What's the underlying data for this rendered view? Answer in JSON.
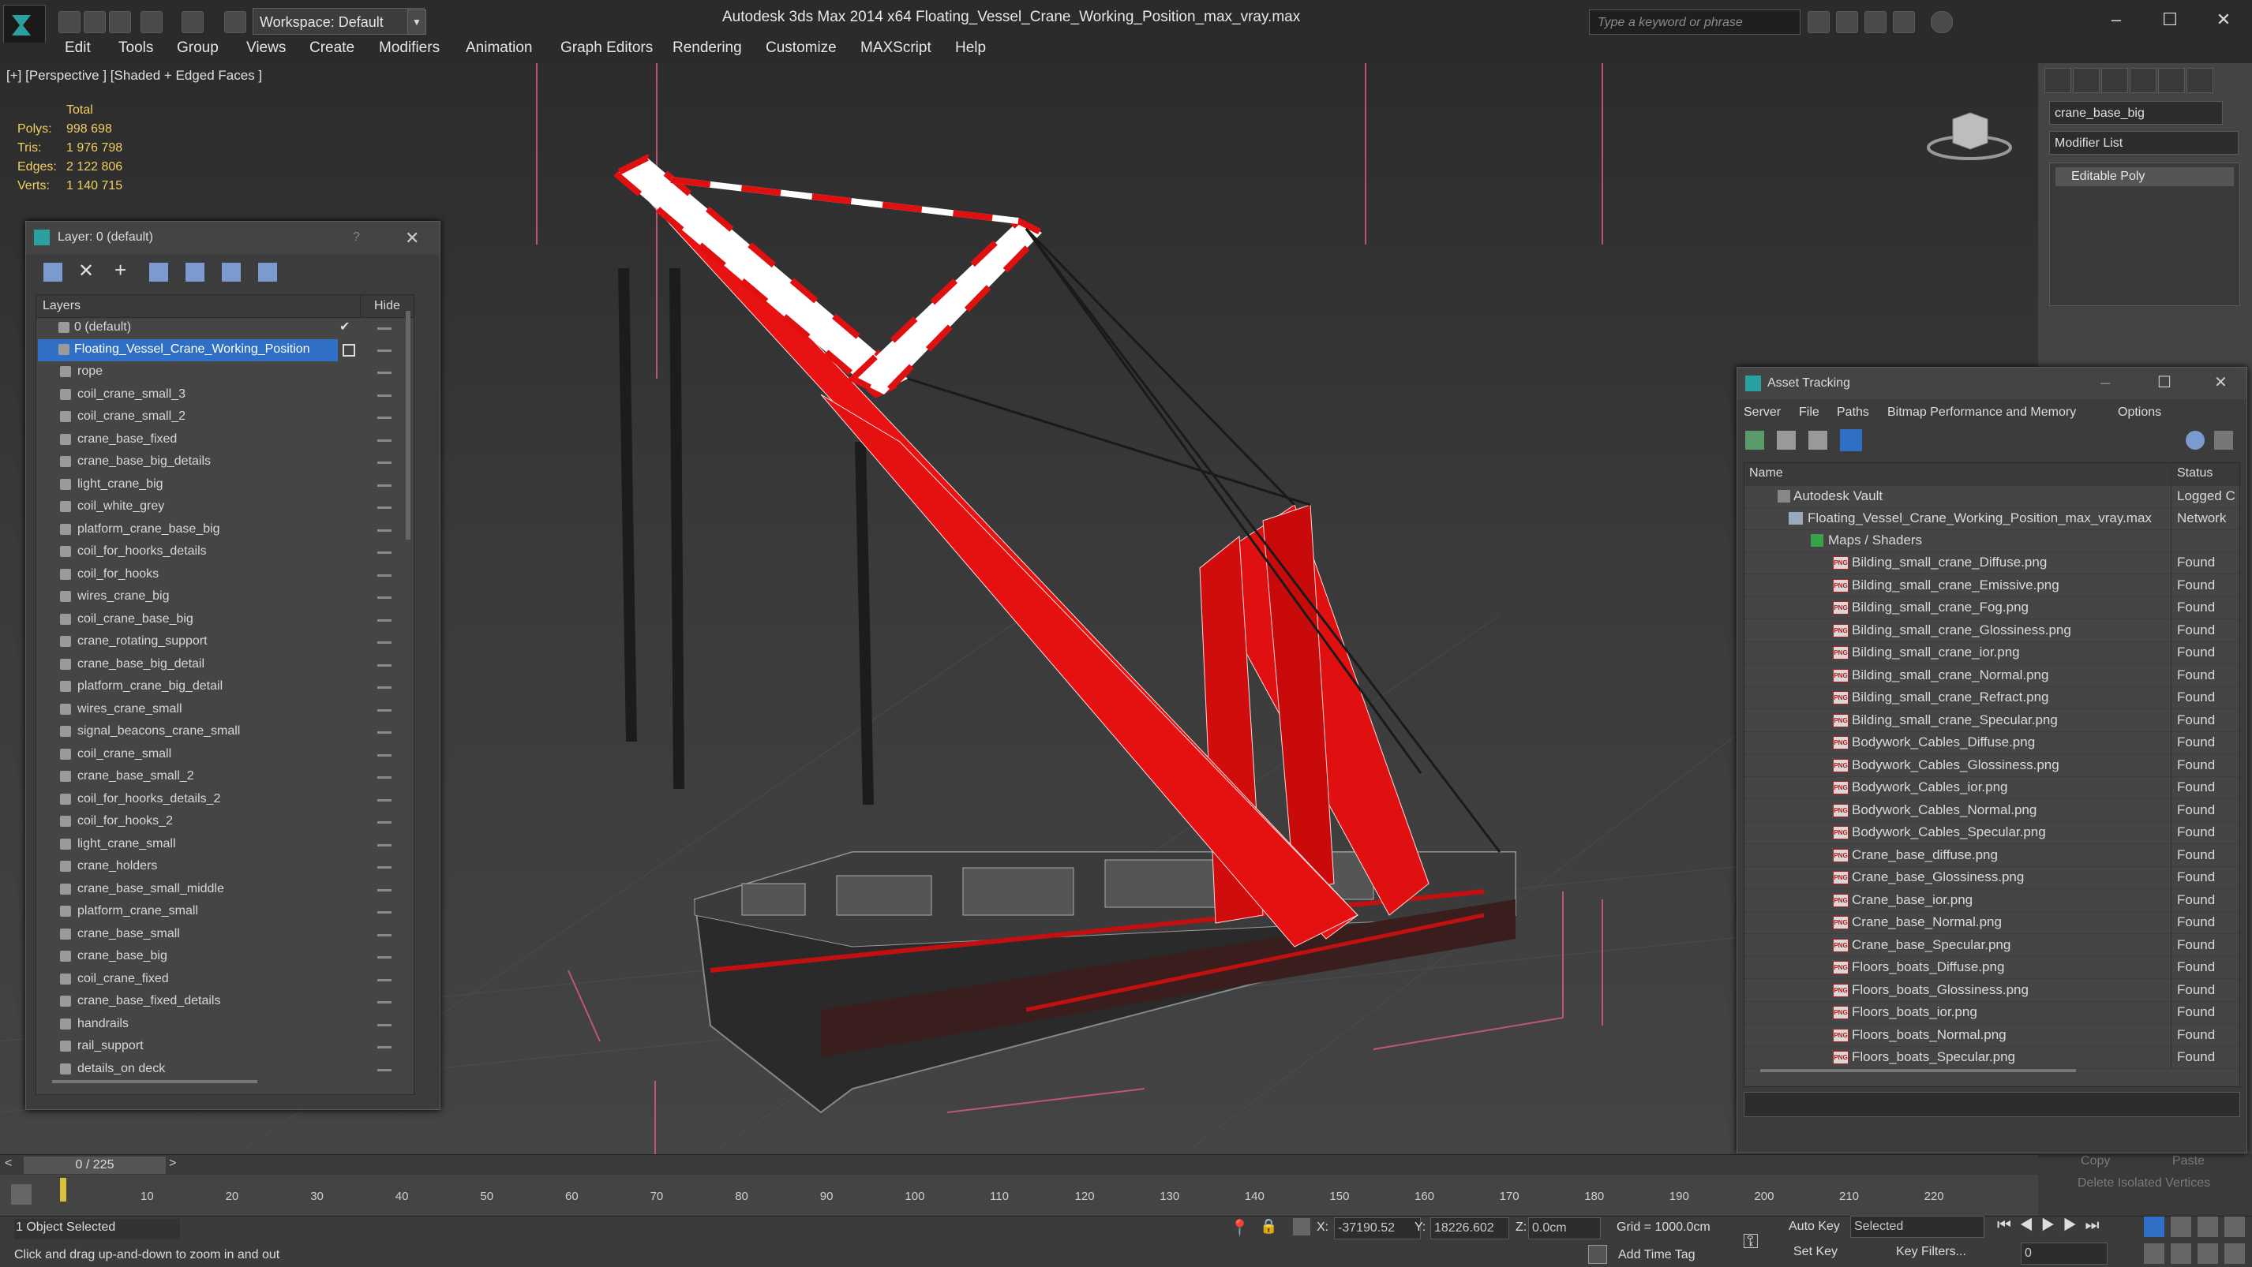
{
  "app": {
    "title": "Autodesk 3ds Max  2014 x64     Floating_Vessel_Crane_Working_Position_max_vray.max",
    "workspace": "Workspace: Default",
    "search_placeholder": "Type a keyword or phrase"
  },
  "menu": [
    "Edit",
    "Tools",
    "Group",
    "Views",
    "Create",
    "Modifiers",
    "Animation",
    "Graph Editors",
    "Rendering",
    "Customize",
    "MAXScript",
    "Help"
  ],
  "viewport": {
    "label": "[+] [Perspective ] [Shaded + Edged Faces ]",
    "stats": {
      "total_label": "Total",
      "rows": [
        {
          "key": "Polys:",
          "value": "998 698"
        },
        {
          "key": "Tris:",
          "value": "1 976 798"
        },
        {
          "key": "Edges:",
          "value": "2 122 806"
        },
        {
          "key": "Verts:",
          "value": "1 140 715"
        }
      ]
    }
  },
  "layer_panel": {
    "title": "Layer: 0 (default)",
    "help": "?",
    "col_layers": "Layers",
    "col_hide": "Hide",
    "default_layer": "0 (default)",
    "selected_layer": "Floating_Vessel_Crane_Working_Position",
    "objects": [
      "rope",
      "coil_crane_small_3",
      "coil_crane_small_2",
      "crane_base_fixed",
      "crane_base_big_details",
      "light_crane_big",
      "coil_white_grey",
      "platform_crane_base_big",
      "coil_for_hoorks_details",
      "coil_for_hooks",
      "wires_crane_big",
      "coil_crane_base_big",
      "crane_rotating_support",
      "crane_base_big_detail",
      "platform_crane_big_detail",
      "wires_crane_small",
      "signal_beacons_crane_small",
      "coil_crane_small",
      "crane_base_small_2",
      "coil_for_hoorks_details_2",
      "coil_for_hooks_2",
      "light_crane_small",
      "crane_holders",
      "crane_base_small_middle",
      "platform_crane_small",
      "crane_base_small",
      "crane_base_big",
      "coil_crane_fixed",
      "crane_base_fixed_details",
      "handrails",
      "rail_support",
      "details_on deck"
    ]
  },
  "command_panel": {
    "object_name": "crane_base_big",
    "modifier_list": "Modifier List",
    "modifier": "Editable Poly",
    "copy": "Copy",
    "paste": "Paste",
    "delete_isolated": "Delete Isolated Vertices"
  },
  "asset_tracking": {
    "title": "Asset Tracking",
    "menu": [
      "Server",
      "File",
      "Paths",
      "Bitmap Performance and Memory",
      "Options"
    ],
    "col_name": "Name",
    "col_status": "Status",
    "vault": {
      "name": "Autodesk Vault",
      "status": "Logged C"
    },
    "file": {
      "name": "Floating_Vessel_Crane_Working_Position_max_vray.max",
      "status": "Network"
    },
    "maps_folder": "Maps / Shaders",
    "maps": [
      {
        "name": "Bilding_small_crane_Diffuse.png",
        "status": "Found"
      },
      {
        "name": "Bilding_small_crane_Emissive.png",
        "status": "Found"
      },
      {
        "name": "Bilding_small_crane_Fog.png",
        "status": "Found"
      },
      {
        "name": "Bilding_small_crane_Glossiness.png",
        "status": "Found"
      },
      {
        "name": "Bilding_small_crane_ior.png",
        "status": "Found"
      },
      {
        "name": "Bilding_small_crane_Normal.png",
        "status": "Found"
      },
      {
        "name": "Bilding_small_crane_Refract.png",
        "status": "Found"
      },
      {
        "name": "Bilding_small_crane_Specular.png",
        "status": "Found"
      },
      {
        "name": "Bodywork_Cables_Diffuse.png",
        "status": "Found"
      },
      {
        "name": "Bodywork_Cables_Glossiness.png",
        "status": "Found"
      },
      {
        "name": "Bodywork_Cables_ior.png",
        "status": "Found"
      },
      {
        "name": "Bodywork_Cables_Normal.png",
        "status": "Found"
      },
      {
        "name": "Bodywork_Cables_Specular.png",
        "status": "Found"
      },
      {
        "name": "Crane_base_diffuse.png",
        "status": "Found"
      },
      {
        "name": "Crane_base_Glossiness.png",
        "status": "Found"
      },
      {
        "name": "Crane_base_ior.png",
        "status": "Found"
      },
      {
        "name": "Crane_base_Normal.png",
        "status": "Found"
      },
      {
        "name": "Crane_base_Specular.png",
        "status": "Found"
      },
      {
        "name": "Floors_boats_Diffuse.png",
        "status": "Found"
      },
      {
        "name": "Floors_boats_Glossiness.png",
        "status": "Found"
      },
      {
        "name": "Floors_boats_ior.png",
        "status": "Found"
      },
      {
        "name": "Floors_boats_Normal.png",
        "status": "Found"
      },
      {
        "name": "Floors_boats_Specular.png",
        "status": "Found"
      }
    ]
  },
  "timeline": {
    "frame": "0 / 225",
    "ticks": [
      "10",
      "20",
      "30",
      "40",
      "50",
      "60",
      "70",
      "80",
      "90",
      "100",
      "110",
      "120",
      "130",
      "140",
      "150",
      "160",
      "170",
      "180",
      "190",
      "200",
      "210",
      "220"
    ]
  },
  "status": {
    "selection": "1 Object Selected",
    "prompt": "Click and drag up-and-down to zoom in and out",
    "x_label": "X:",
    "x_value": "-37190.52",
    "y_label": "Y:",
    "y_value": "18226.602",
    "z_label": "Z:",
    "z_value": "0.0cm",
    "grid": "Grid = 1000.0cm",
    "add_time_tag": "Add Time Tag",
    "auto_key": "Auto Key",
    "set_key": "Set Key",
    "selected": "Selected",
    "key_filters": "Key Filters...",
    "current_frame": "0"
  },
  "colors": {
    "accent": "#2f6fc6",
    "crane_red": "#e01010"
  }
}
